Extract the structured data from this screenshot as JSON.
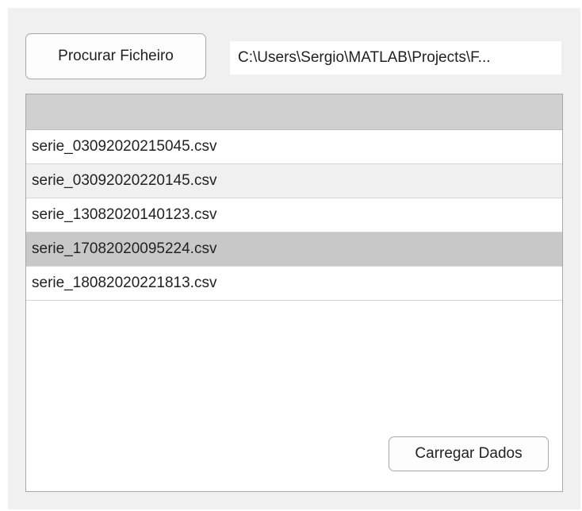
{
  "browse": {
    "button_label": "Procurar Ficheiro",
    "path_value": "C:\\Users\\Sergio\\MATLAB\\Projects\\F..."
  },
  "file_list": {
    "items": [
      {
        "label": "serie_03092020215045.csv",
        "selected": false
      },
      {
        "label": "serie_03092020220145.csv",
        "selected": false
      },
      {
        "label": "serie_13082020140123.csv",
        "selected": false
      },
      {
        "label": "serie_17082020095224.csv",
        "selected": true
      },
      {
        "label": "serie_18082020221813.csv",
        "selected": false
      }
    ]
  },
  "actions": {
    "load_label": "Carregar Dados"
  }
}
